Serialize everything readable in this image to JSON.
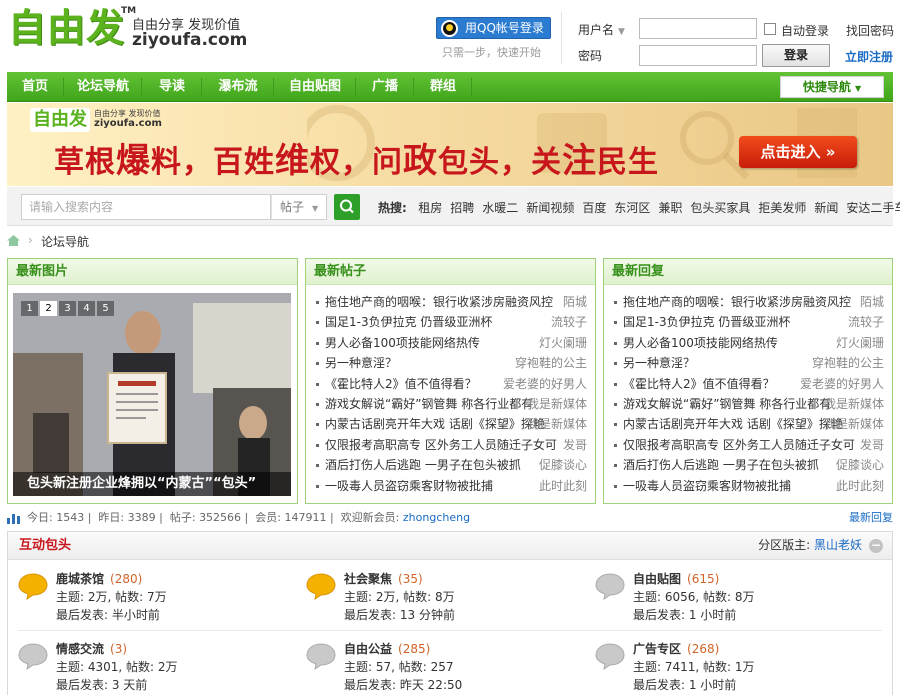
{
  "header": {
    "logo_text": "自由发",
    "logo_tm": "TM",
    "slogan": "自由分享 发现价值",
    "domain": "ziyoufa.com",
    "qq_login_label": "用QQ帐号登录",
    "qq_hint": "只需一步，快速开始",
    "username_label": "用户名",
    "password_label": "密码",
    "remember_label": "自动登录",
    "find_password": "找回密码",
    "login_button": "登录",
    "register_link": "立即注册"
  },
  "nav": {
    "items": [
      "首页",
      "论坛导航",
      "导读",
      "瀑布流",
      "自由贴图",
      "广播",
      "群组"
    ],
    "quick_nav": "快捷导航"
  },
  "banner": {
    "logo_text": "自由发",
    "slogan": "自由分享 发现价值",
    "domain": "ziyoufa.com",
    "headline_parts": [
      "草根",
      "爆",
      "料，百姓",
      "维",
      "权，问",
      "政",
      "包头，关",
      "注",
      "民生"
    ],
    "enter_button": "点击进入 »"
  },
  "search": {
    "placeholder": "请输入搜索内容",
    "type": "帖子",
    "hot_label": "热搜:",
    "hot": [
      "租房",
      "招聘",
      "水暖二",
      "新闻视频",
      "百度",
      "东河区",
      "兼职",
      "包头买家具",
      "拒美发师",
      "新闻",
      "安达二手车"
    ]
  },
  "breadcrumb": {
    "current": "论坛导航"
  },
  "panels": {
    "pics": {
      "title": "最新图片",
      "slides": [
        "1",
        "2",
        "3",
        "4",
        "5"
      ],
      "caption": "包头新注册企业烽拥以“内蒙古”“包头”"
    },
    "threads": {
      "title": "最新帖子",
      "rows": [
        {
          "t": "拖住地产商的咽喉：银行收紧涉房融资风控",
          "a": "陌城"
        },
        {
          "t": "国足1-3负伊拉克 仍晋级亚洲杯",
          "a": "流较子"
        },
        {
          "t": "男人必备100项技能网络热传",
          "a": "灯火阑珊"
        },
        {
          "t": "另一种意淫？",
          "a": "穿袍鞋的公主"
        },
        {
          "t": "《霍比特人2》值不值得看？",
          "a": "爱老婆的好男人"
        },
        {
          "t": "游戏女解说“霸好”钢管舞 称各行业都有",
          "a": "我是新媒体"
        },
        {
          "t": "内蒙古话剧亮开年大戏 话剧《探望》探艳",
          "a": "我是新媒体"
        },
        {
          "t": "仅限报考高职高专 区外务工人员随迁子女可",
          "a": "发哥"
        },
        {
          "t": "酒后打伤人后逃跑 一男子在包头被抓",
          "a": "促膝谈心"
        },
        {
          "t": "一吸毒人员盗窃乘客财物被批捕",
          "a": "此时此刻"
        }
      ]
    },
    "replies": {
      "title": "最新回复",
      "rows": [
        {
          "t": "拖住地产商的咽喉：银行收紧涉房融资风控",
          "a": "陌城"
        },
        {
          "t": "国足1-3负伊拉克 仍晋级亚洲杯",
          "a": "流较子"
        },
        {
          "t": "男人必备100项技能网络热传",
          "a": "灯火阑珊"
        },
        {
          "t": "另一种意淫？",
          "a": "穿袍鞋的公主"
        },
        {
          "t": "《霍比特人2》值不值得看？",
          "a": "爱老婆的好男人"
        },
        {
          "t": "游戏女解说“霸好”钢管舞 称各行业都有",
          "a": "我是新媒体"
        },
        {
          "t": "内蒙古话剧亮开年大戏 话剧《探望》探艳",
          "a": "我是新媒体"
        },
        {
          "t": "仅限报考高职高专 区外务工人员随迁子女可",
          "a": "发哥"
        },
        {
          "t": "酒后打伤人后逃跑 一男子在包头被抓",
          "a": "促膝谈心"
        },
        {
          "t": "一吸毒人员盗窃乘客财物被批捕",
          "a": "此时此刻"
        }
      ]
    }
  },
  "stats": {
    "today_label": "今日:",
    "today": "1543",
    "yesterday_label": "昨日:",
    "yesterday": "3389",
    "posts_label": "帖子:",
    "posts": "352566",
    "members_label": "会员:",
    "members": "147911",
    "welcome_label": "欢迎新会员:",
    "new_member": "zhongcheng",
    "latest_replies": "最新回复"
  },
  "section": {
    "title": "互动包头",
    "moderator_label": "分区版主:",
    "moderator": "黑山老妖",
    "collapse": "−",
    "forums": [
      {
        "name": "鹿城茶馆",
        "count": "(280)",
        "topics": "主题: 2万, 帖数: 7万",
        "last": "最后发表: 半小时前",
        "active": true
      },
      {
        "name": "社会聚焦",
        "count": "(35)",
        "topics": "主题: 2万, 帖数: 8万",
        "last": "最后发表: 13 分钟前",
        "active": true
      },
      {
        "name": "自由贴图",
        "count": "(615)",
        "topics": "主题: 6056, 帖数: 8万",
        "last": "最后发表: 1 小时前",
        "active": false
      },
      {
        "name": "情感交流",
        "count": "(3)",
        "topics": "主题: 4301, 帖数: 2万",
        "last": "最后发表: 3 天前",
        "active": false
      },
      {
        "name": "自由公益",
        "count": "(285)",
        "topics": "主题: 57, 帖数: 257",
        "last": "最后发表: 昨天 22:50",
        "active": false
      },
      {
        "name": "广告专区",
        "count": "(268)",
        "topics": "主题: 7411, 帖数: 1万",
        "last": "最后发表: 1 小时前",
        "active": false
      }
    ]
  },
  "colors": {
    "brand_green": "#4fb427",
    "headline_red": "#c8161d",
    "link_blue": "#1a6bc4"
  }
}
